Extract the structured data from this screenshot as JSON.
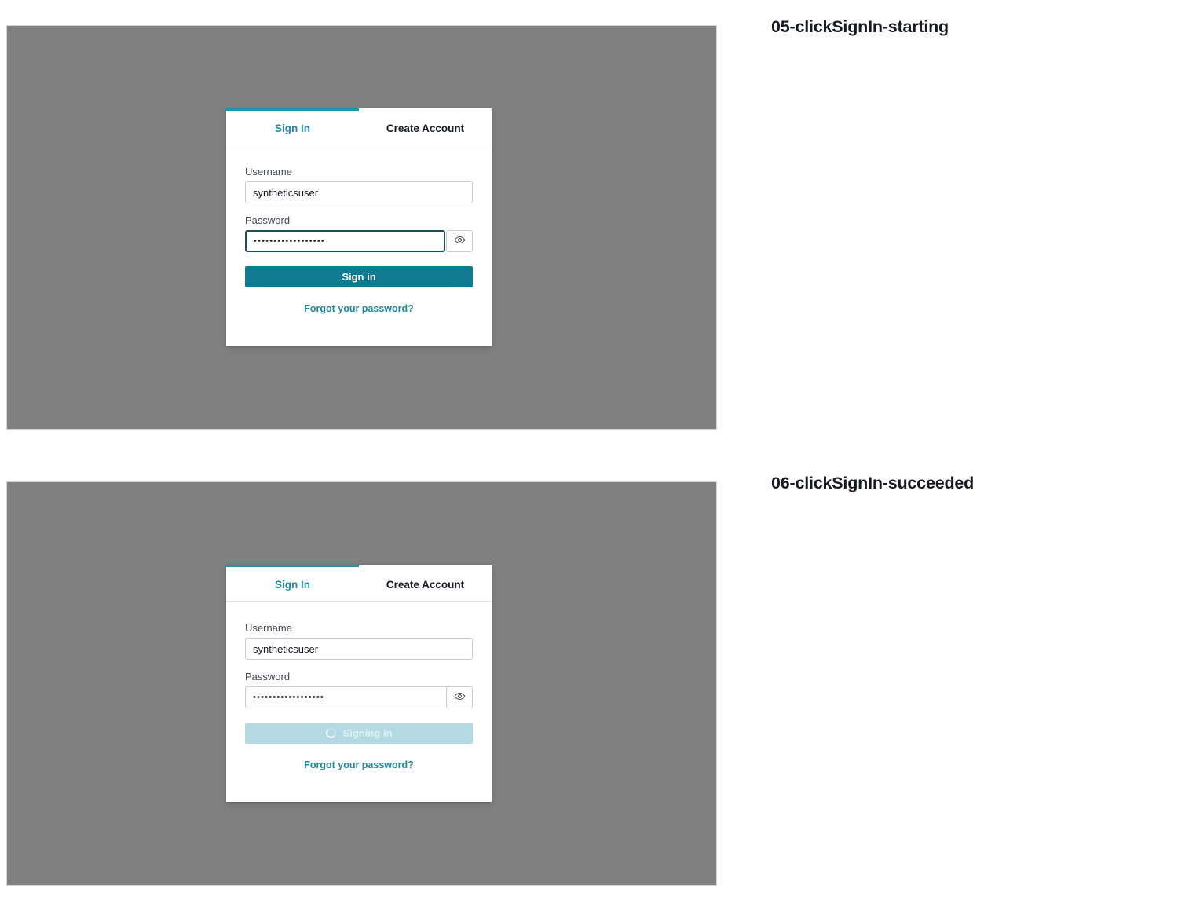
{
  "captures": [
    {
      "caption": "05-clickSignIn-starting",
      "viewport_background": "#808080",
      "card": {
        "tabs": [
          {
            "label": "Sign In",
            "active": true
          },
          {
            "label": "Create Account",
            "active": false
          }
        ],
        "username": {
          "label": "Username",
          "value": "syntheticsuser",
          "placeholder": "Username"
        },
        "password": {
          "label": "Password",
          "value": "••••••••••••••••••",
          "placeholder": "Password",
          "focused": true,
          "toggle_icon": "eye-icon"
        },
        "submit": {
          "label": "Sign in",
          "state": "idle",
          "color": "#0f7b92"
        },
        "forgot_link": "Forgot your password?"
      }
    },
    {
      "caption": "06-clickSignIn-succeeded",
      "viewport_background": "#808080",
      "card": {
        "tabs": [
          {
            "label": "Sign In",
            "active": true
          },
          {
            "label": "Create Account",
            "active": false
          }
        ],
        "username": {
          "label": "Username",
          "value": "syntheticsuser",
          "placeholder": "Username"
        },
        "password": {
          "label": "Password",
          "value": "••••••••••••••••••",
          "placeholder": "Password",
          "focused": false,
          "toggle_icon": "eye-icon"
        },
        "submit": {
          "label": "Signing in",
          "state": "loading",
          "color": "#b3d9e2",
          "spinner_icon": "spinner-icon"
        },
        "forgot_link": "Forgot your password?"
      }
    }
  ],
  "theme": {
    "accent": "#0f7b92",
    "tab_active": "#2195b0",
    "link": "#1f87a0",
    "backdrop": "#808080",
    "focus_border": "#17505c"
  }
}
